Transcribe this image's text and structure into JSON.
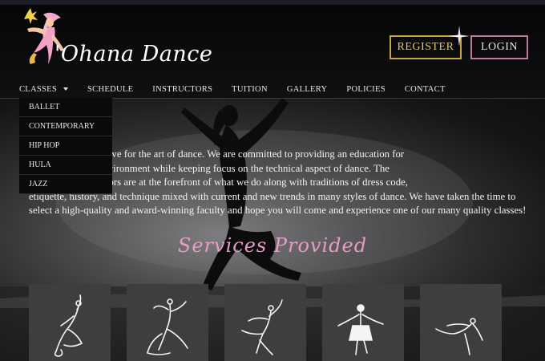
{
  "brand": {
    "name": "'Ohana Dance"
  },
  "header": {
    "register_label": "REGISTER",
    "login_label": "LOGIN"
  },
  "nav": [
    {
      "label": "CLASSES"
    },
    {
      "label": "SCHEDULE"
    },
    {
      "label": "INSTRUCTORS"
    },
    {
      "label": "TUITION"
    },
    {
      "label": "GALLERY"
    },
    {
      "label": "POLICIES"
    },
    {
      "label": "CONTACT"
    }
  ],
  "classes_dropdown": [
    {
      "label": "BALLET"
    },
    {
      "label": "CONTEMPORARY"
    },
    {
      "label": "HIP HOP"
    },
    {
      "label": "HULA"
    },
    {
      "label": "JAZZ"
    }
  ],
  "intro": {
    "lines": [
      "trong passion and love for the art of dance.  We are committed to providing an education for",
      "rturing, and safe environment while keeping focus on the technical aspect of dance.  The",
      "lancers and instructors are at the forefront of what we do along with traditions of dress code,",
      "etiquette, history, and technique mixed with current and new trends in many styles of dance. We have taken the time to",
      "select a high-quality and award-winning faculty and hope you will come and experience one of our many quality classes!"
    ]
  },
  "services": {
    "title": "Services Provided"
  },
  "icons": {
    "logo": "dancer-logo-icon",
    "sparkle": "sparkle-icon"
  },
  "colors": {
    "accent_gold": "#c9a83a",
    "accent_pink": "#e79bc7",
    "login_border": "#c07a9e"
  }
}
